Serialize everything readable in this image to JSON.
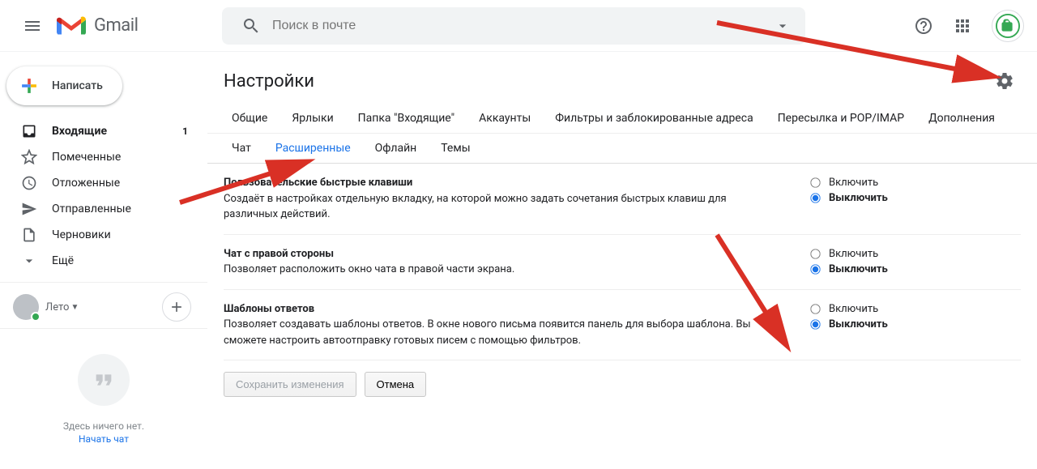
{
  "header": {
    "brand": "Gmail",
    "search_placeholder": "Поиск в почте"
  },
  "sidebar": {
    "compose": "Написать",
    "items": [
      {
        "label": "Входящие",
        "count": "1"
      },
      {
        "label": "Помеченные"
      },
      {
        "label": "Отложенные"
      },
      {
        "label": "Отправленные"
      },
      {
        "label": "Черновики"
      },
      {
        "label": "Ещё"
      }
    ],
    "chat_user": "Лето",
    "hangout_empty": "Здесь ничего нет.",
    "hangout_start": "Начать чат"
  },
  "settings": {
    "title": "Настройки",
    "tabs_row1": [
      "Общие",
      "Ярлыки",
      "Папка \"Входящие\"",
      "Аккаунты",
      "Фильтры и заблокированные адреса",
      "Пересылка и POP/IMAP",
      "Дополнения"
    ],
    "tabs_row2": [
      "Чат",
      "Расширенные",
      "Офлайн",
      "Темы"
    ],
    "active_tab": "Расширенные",
    "options": [
      {
        "title": "Пользовательские быстрые клавиши",
        "desc": "Создаёт в настройках отдельную вкладку, на которой можно задать сочетания быстрых клавиш для различных действий.",
        "selected": "off"
      },
      {
        "title": "Чат с правой стороны",
        "desc": "Позволяет расположить окно чата в правой части экрана.",
        "selected": "off"
      },
      {
        "title": "Шаблоны ответов",
        "desc": "Позволяет создавать шаблоны ответов. В окне нового письма появится панель для выбора шаблона. Вы сможете настроить автоотправку готовых писем с помощью фильтров.",
        "selected": "off"
      }
    ],
    "radio_on": "Включить",
    "radio_off": "Выключить",
    "save_btn": "Сохранить изменения",
    "cancel_btn": "Отмена"
  }
}
